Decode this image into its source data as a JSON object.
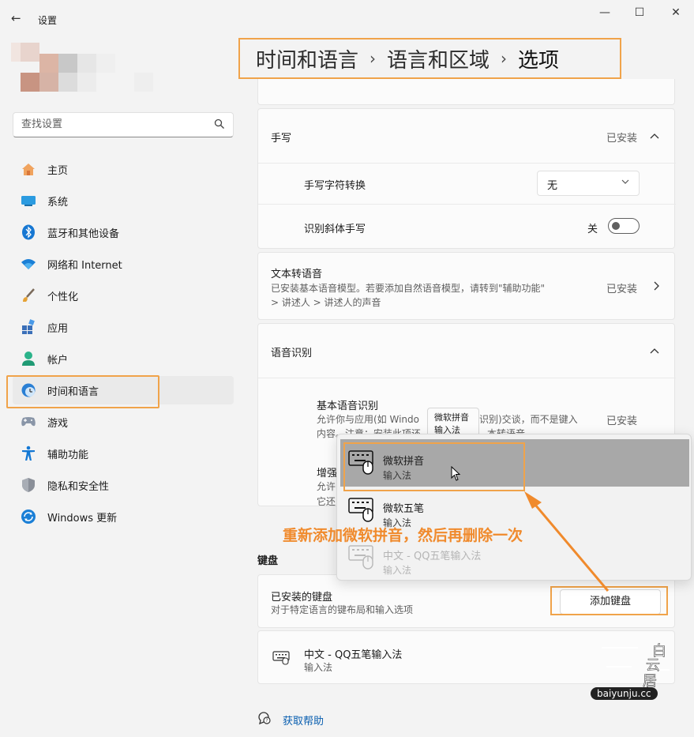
{
  "window": {
    "back_glyph": "←",
    "title": "设置",
    "minimize_glyph": "—",
    "maximize_glyph": "☐",
    "close_glyph": "✕"
  },
  "search": {
    "placeholder": "查找设置"
  },
  "sidebar": {
    "items": [
      {
        "label": "主页",
        "icon": "home-icon"
      },
      {
        "label": "系统",
        "icon": "system-icon"
      },
      {
        "label": "蓝牙和其他设备",
        "icon": "bluetooth-icon"
      },
      {
        "label": "网络和 Internet",
        "icon": "wifi-icon"
      },
      {
        "label": "个性化",
        "icon": "brush-icon"
      },
      {
        "label": "应用",
        "icon": "apps-icon"
      },
      {
        "label": "帐户",
        "icon": "account-icon"
      },
      {
        "label": "时间和语言",
        "icon": "time-language-icon",
        "active": true
      },
      {
        "label": "游戏",
        "icon": "gamepad-icon"
      },
      {
        "label": "辅助功能",
        "icon": "accessibility-icon"
      },
      {
        "label": "隐私和安全性",
        "icon": "shield-icon"
      },
      {
        "label": "Windows 更新",
        "icon": "update-icon"
      }
    ]
  },
  "breadcrumb": {
    "part1": "时间和语言",
    "sep1": "›",
    "part2": "语言和区域",
    "sep2": "›",
    "current": "选项"
  },
  "handwriting": {
    "title": "手写",
    "status": "已安装",
    "char_convert_label": "手写字符转换",
    "char_convert_value": "无",
    "italic_label": "识别斜体手写",
    "italic_state": "关"
  },
  "tts": {
    "title": "文本转语音",
    "desc_line1": "已安装基本语音模型。若要添加自然语音模型，请转到\"辅助功能\"",
    "desc_line2": "> 讲述人 > 讲述人的声音",
    "status": "已安装"
  },
  "speech": {
    "title": "语音识别",
    "basic_title": "基本语音识别",
    "basic_desc_line1": "允许你与应用(如 Windo",
    "basic_desc_line1b": "识别)交谈，而不是键入",
    "basic_desc_line2": "内容。注意：安装此项还",
    "basic_desc_line2b": "本转语音",
    "basic_status": "已安装",
    "enhanced_title": "增强",
    "enhanced_desc1": "允许",
    "enhanced_desc2": "它还"
  },
  "keyboard": {
    "section_title": "键盘",
    "installed_title": "已安装的键盘",
    "installed_desc": "对于特定语言的键布局和输入选项",
    "add_button": "添加键盘",
    "item_title": "中文 - QQ五笔输入法",
    "item_sub": "输入法"
  },
  "popup": {
    "items": [
      {
        "title": "微软拼音",
        "sub": "输入法"
      },
      {
        "title": "微软五笔",
        "sub": "输入法"
      },
      {
        "title": "中文 - QQ五笔输入法",
        "sub": "输入法"
      }
    ]
  },
  "tooltip": {
    "line1": "微软拼音",
    "line2": "输入法"
  },
  "annotation": {
    "text": "重新添加微软拼音，然后再删除一次"
  },
  "help": {
    "label": "获取帮助"
  },
  "watermark": {
    "text": "baiyunju.cc",
    "chars": "白云居"
  },
  "colors": {
    "highlight": "#f0a34a",
    "annotation": "#f08a2c",
    "link": "#0a5fb0"
  }
}
